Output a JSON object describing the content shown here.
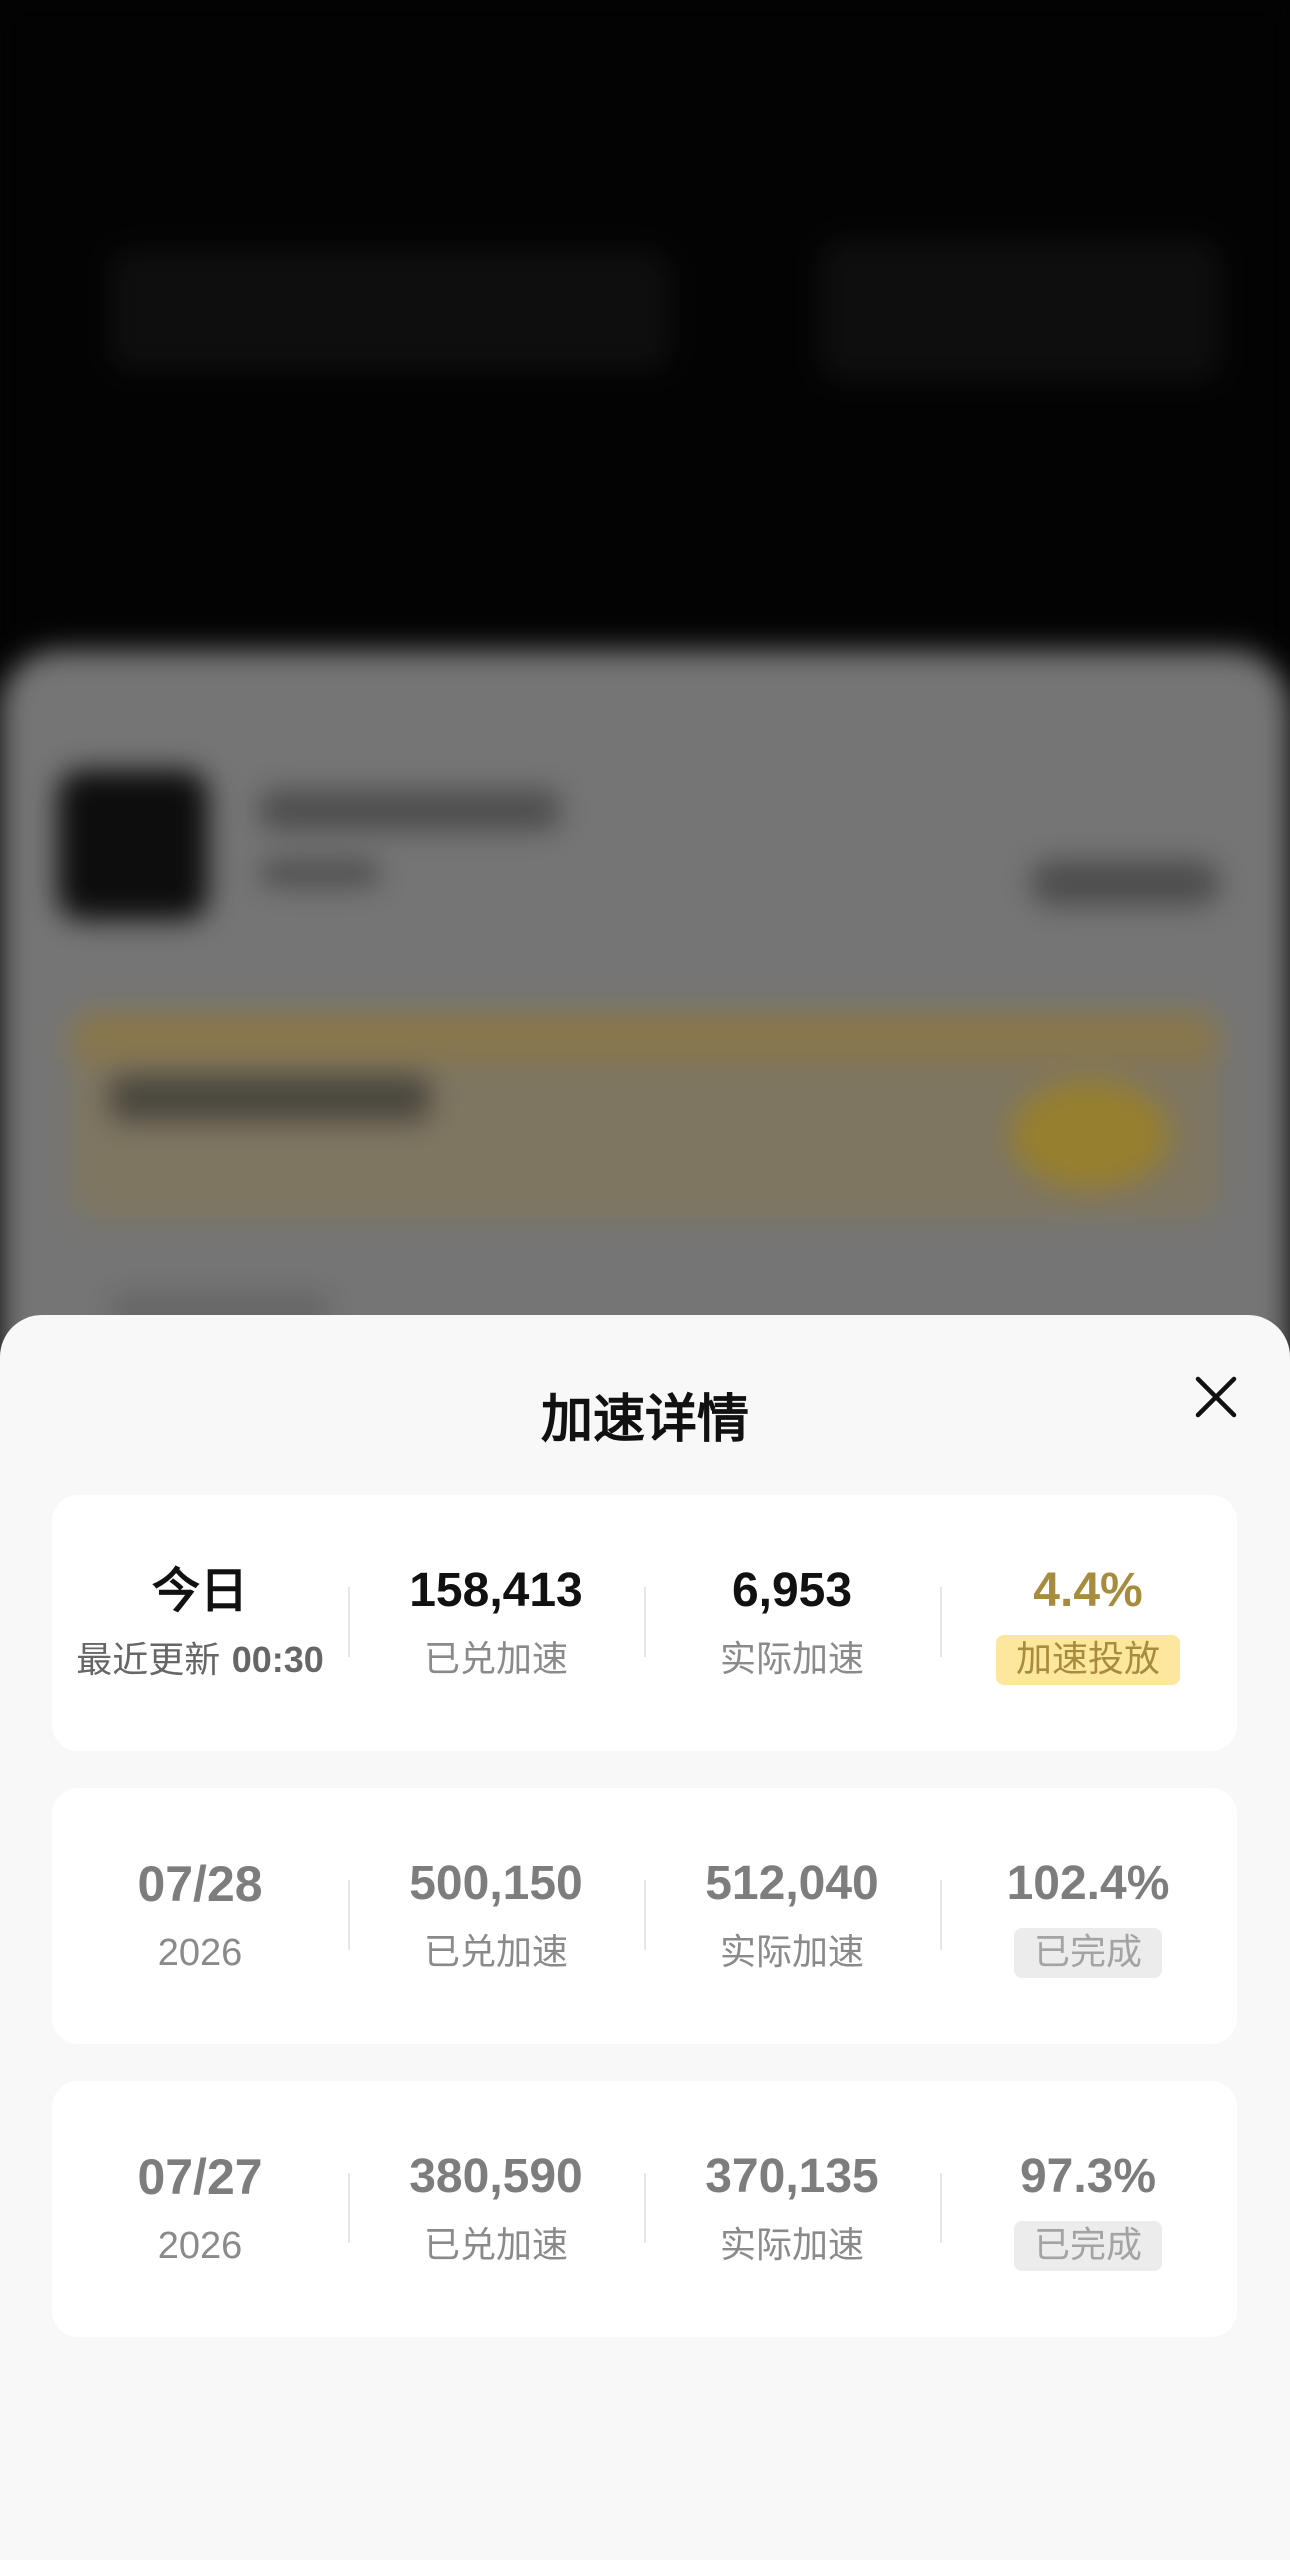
{
  "sheet": {
    "title": "加速详情"
  },
  "today": {
    "label": "今日",
    "update_prefix": "最近更新 ",
    "update_time": "00:30",
    "redeemed_value": "158,413",
    "redeemed_label": "已兑加速",
    "actual_value": "6,953",
    "actual_label": "实际加速",
    "percent": "4.4%",
    "status": "加速投放"
  },
  "history": [
    {
      "date": "07/28",
      "year": "2026",
      "redeemed_value": "500,150",
      "redeemed_label": "已兑加速",
      "actual_value": "512,040",
      "actual_label": "实际加速",
      "percent": "102.4%",
      "status": "已完成"
    },
    {
      "date": "07/27",
      "year": "2026",
      "redeemed_value": "380,590",
      "redeemed_label": "已兑加速",
      "actual_value": "370,135",
      "actual_label": "实际加速",
      "percent": "97.3%",
      "status": "已完成"
    }
  ],
  "colors": {
    "accent_gold": "#a88c3e",
    "badge_gold_bg": "#fde79d",
    "badge_grey_bg": "#ececec"
  },
  "icons": {
    "close": "close-icon"
  }
}
